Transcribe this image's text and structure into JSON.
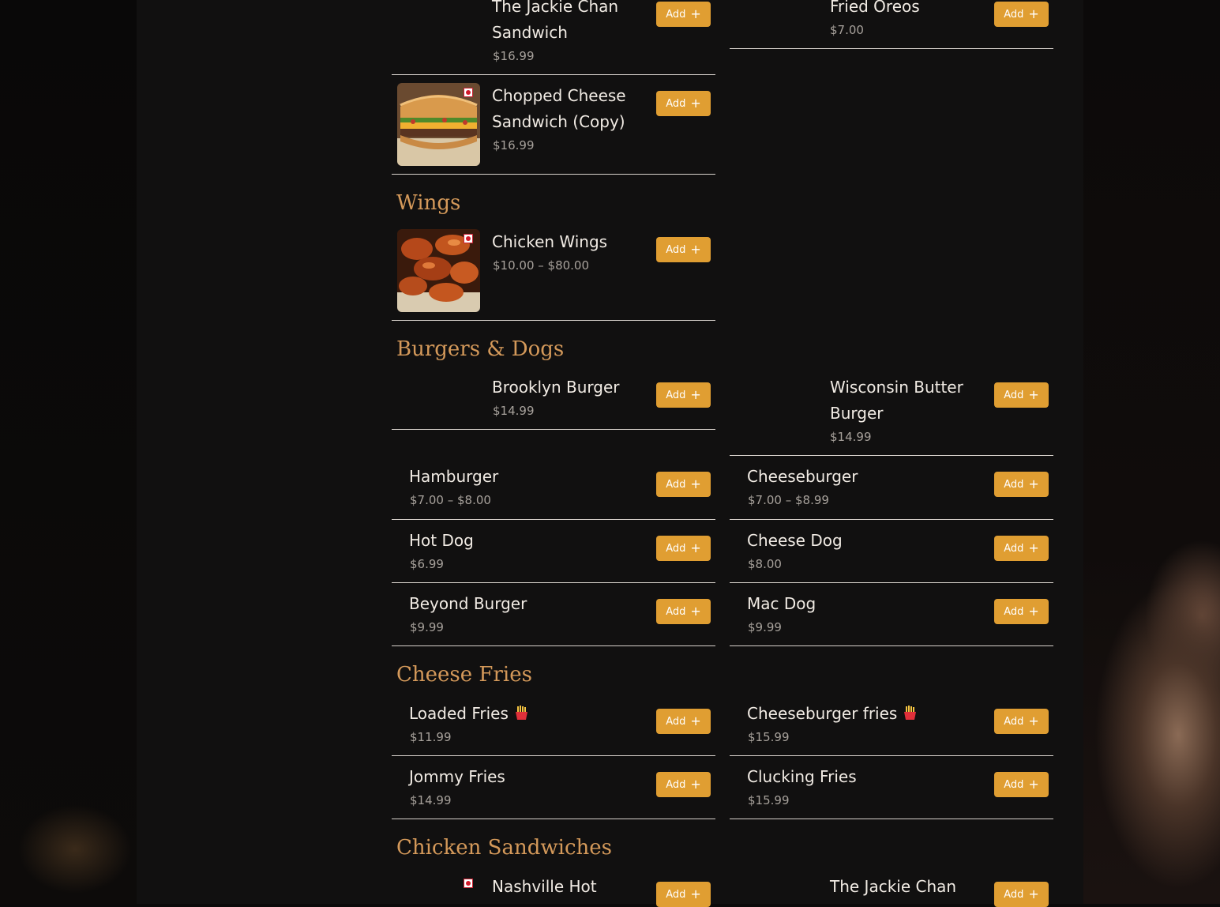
{
  "colors": {
    "accent": "#e09e32",
    "category": "#d4995a",
    "panel": "#111010",
    "divider": "#d8d2cc"
  },
  "add_label": "Add",
  "add_icon": "plus-icon",
  "categories": {
    "wings": "Wings",
    "burgers": "Burgers & Dogs",
    "fries": "Cheese Fries",
    "chicken": "Chicken Sandwiches"
  },
  "items": {
    "jackie_chan_top": {
      "name": "The Jackie Chan Sandwich",
      "price": "$16.99"
    },
    "fried_oreos": {
      "name": "Fried Oreos",
      "price": "$7.00"
    },
    "chopped_cheese": {
      "name": "Chopped Cheese Sandwich (Copy)",
      "price": "$16.99",
      "image": "sandwich-image"
    },
    "chicken_wings": {
      "name": "Chicken Wings",
      "price": "$10.00 – $80.00",
      "image": "wings-image"
    },
    "brooklyn_burger": {
      "name": "Brooklyn Burger",
      "price": "$14.99"
    },
    "wisconsin_burger": {
      "name": "Wisconsin Butter Burger",
      "price": "$14.99"
    },
    "hamburger": {
      "name": "Hamburger",
      "price": "$7.00 – $8.00"
    },
    "cheeseburger": {
      "name": "Cheeseburger",
      "price": "$7.00 – $8.99"
    },
    "hot_dog": {
      "name": "Hot Dog",
      "price": "$6.99"
    },
    "cheese_dog": {
      "name": "Cheese Dog",
      "price": "$8.00"
    },
    "beyond_burger": {
      "name": "Beyond Burger",
      "price": "$9.99"
    },
    "mac_dog": {
      "name": "Mac Dog",
      "price": "$9.99"
    },
    "loaded_fries": {
      "name": "Loaded Fries",
      "price": "$11.99",
      "icon": "fries-emoji-icon"
    },
    "cheeseburger_fries": {
      "name": "Cheeseburger fries",
      "price": "$15.99",
      "icon": "fries-emoji-icon"
    },
    "jommy_fries": {
      "name": "Jommy Fries",
      "price": "$14.99"
    },
    "clucking_fries": {
      "name": "Clucking Fries",
      "price": "$15.99"
    },
    "nashville_hot": {
      "name": "Nashville Hot"
    },
    "jackie_chan_bottom": {
      "name": "The Jackie Chan"
    }
  }
}
